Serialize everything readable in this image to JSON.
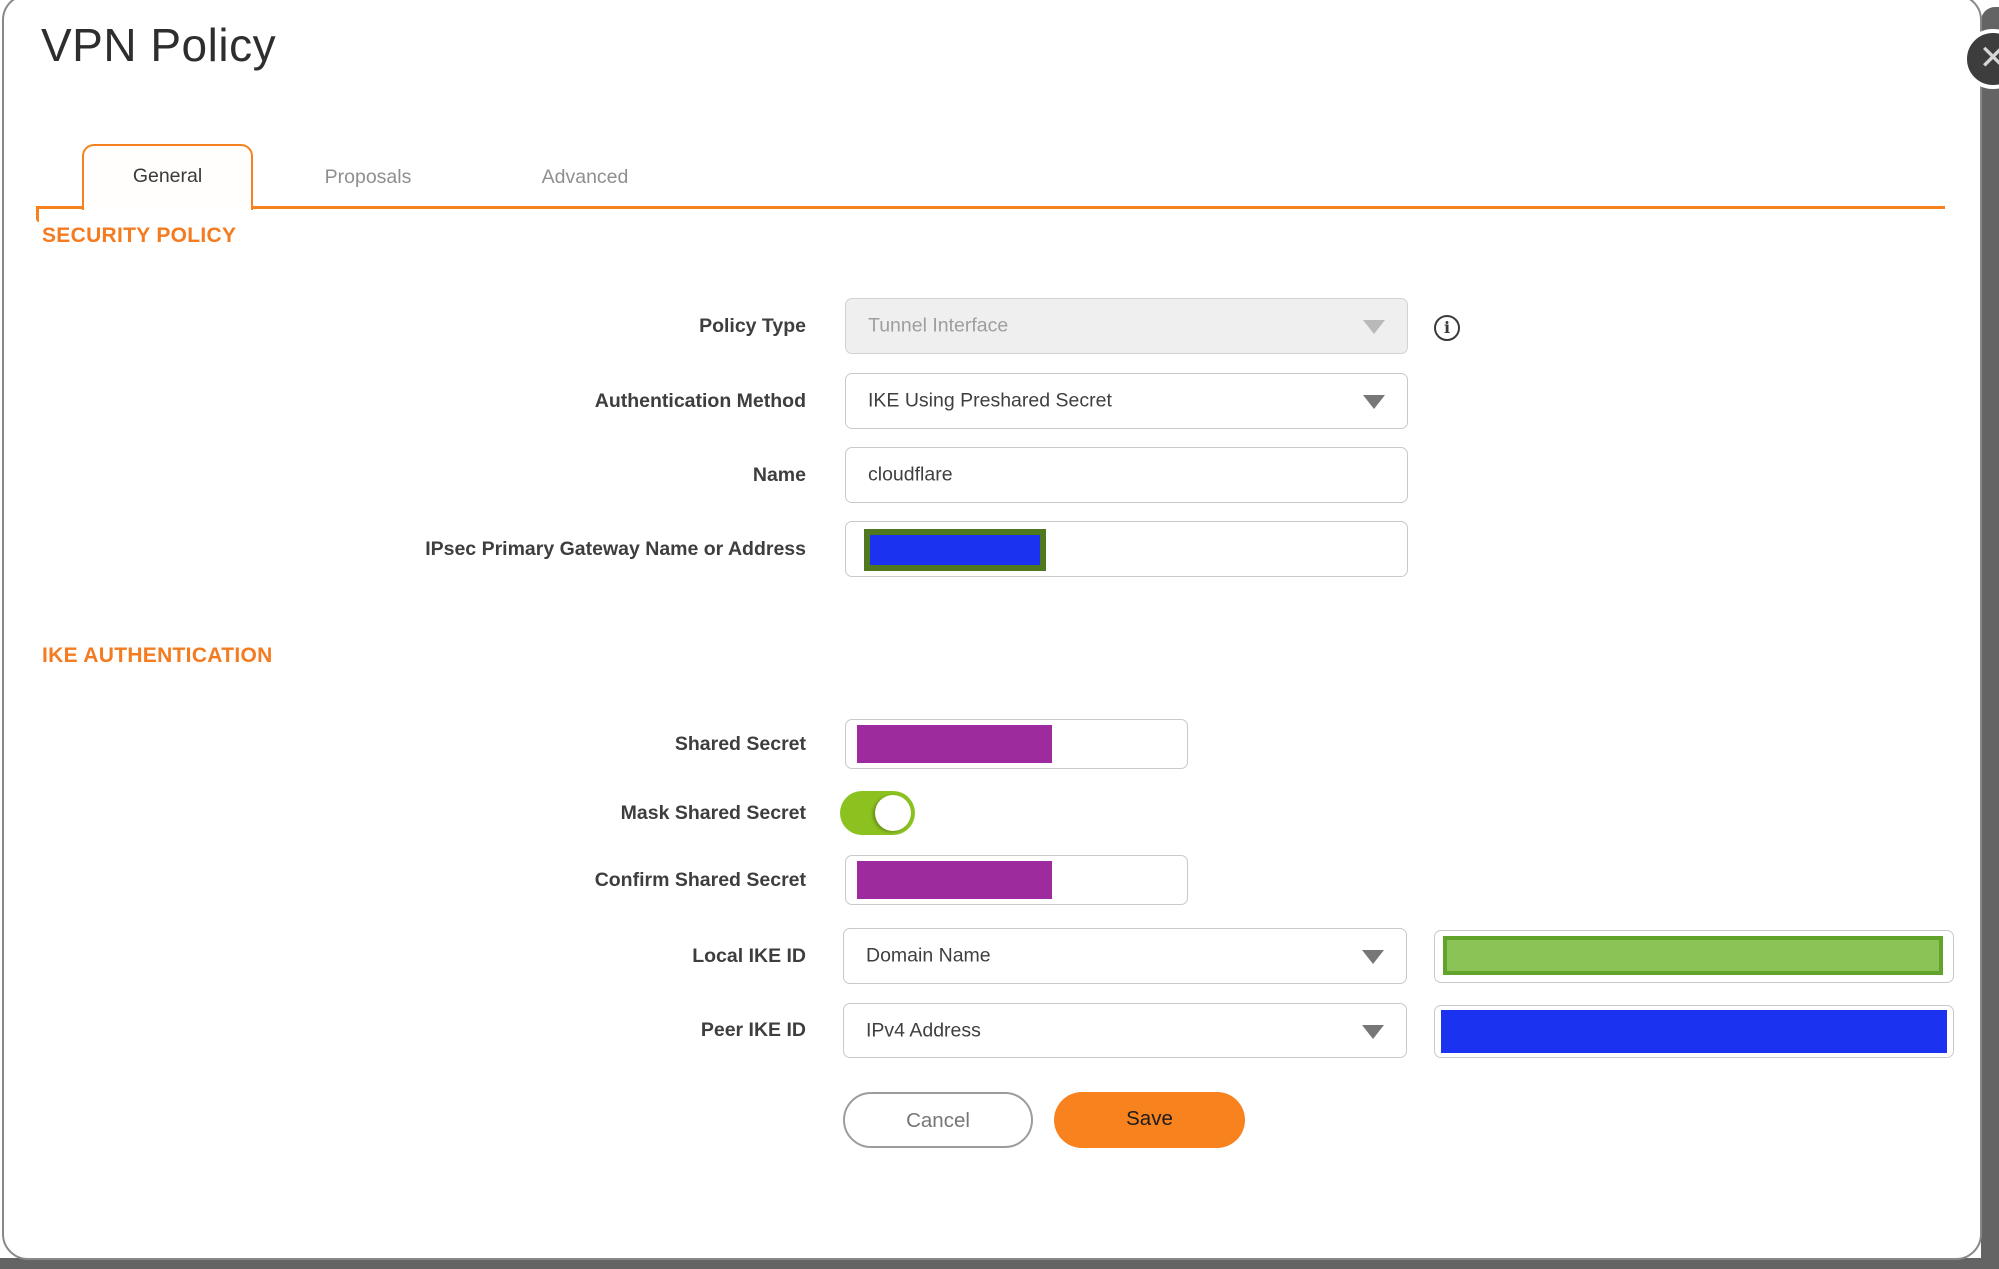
{
  "modal": {
    "title": "VPN Policy",
    "close_icon": "✕"
  },
  "tabs": {
    "general": {
      "label": "General",
      "active": true
    },
    "proposals": {
      "label": "Proposals",
      "active": false
    },
    "advanced": {
      "label": "Advanced",
      "active": false
    }
  },
  "sections": {
    "security_policy": "SECURITY POLICY",
    "ike_authentication": "IKE AUTHENTICATION"
  },
  "fields": {
    "policy_type": {
      "label": "Policy Type",
      "value": "Tunnel Interface",
      "disabled": true,
      "info_icon": "i"
    },
    "auth_method": {
      "label": "Authentication Method",
      "value": "IKE Using Preshared Secret"
    },
    "name": {
      "label": "Name",
      "value": "cloudflare"
    },
    "gateway": {
      "label": "IPsec Primary Gateway Name or Address",
      "value": "",
      "value_state": "redacted"
    },
    "shared_secret": {
      "label": "Shared Secret",
      "value": "",
      "value_state": "redacted"
    },
    "mask_shared_secret": {
      "label": "Mask Shared Secret",
      "state": "on"
    },
    "confirm_shared_secret": {
      "label": "Confirm Shared Secret",
      "value": "",
      "value_state": "redacted"
    },
    "local_ike_id": {
      "label": "Local IKE ID",
      "value": "Domain Name",
      "extra_value_state": "redacted"
    },
    "peer_ike_id": {
      "label": "Peer IKE ID",
      "value": "IPv4 Address",
      "extra_value_state": "redacted"
    }
  },
  "buttons": {
    "cancel": "Cancel",
    "save": "Save"
  },
  "colors": {
    "accent_orange": "#F5821F",
    "save_orange": "#F8821D",
    "heading_orange": "#F47B20",
    "redaction_purple": "#9D2B9D",
    "redaction_blue": "#1B33F0",
    "redaction_olive_border": "#50791F",
    "redaction_green_fill": "#8CC356",
    "redaction_green_border": "#61A32B",
    "toggle_green": "#8CC220",
    "backdrop_grey": "#646464"
  }
}
